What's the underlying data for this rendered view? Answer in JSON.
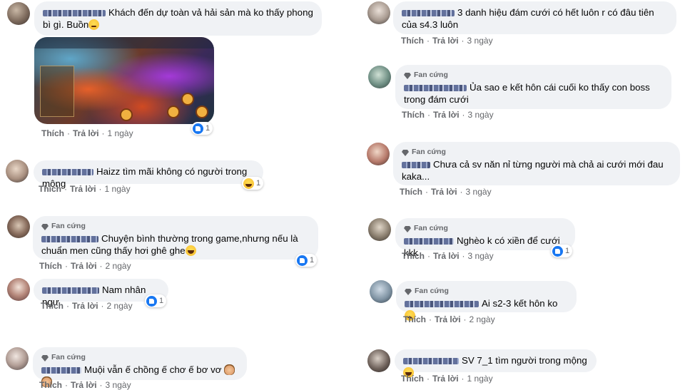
{
  "actions": {
    "like": "Thích",
    "reply": "Trả lời"
  },
  "badge_label": "Fan cứng",
  "comments": [
    {
      "text": "Khách đến dự toàn vả hải sản mà ko thấy phong bì gì. Buồn",
      "time": "1 ngày",
      "reaction_count": "1",
      "reaction": "like"
    },
    {
      "text": "Haizz tìm mãi không có người trong mộng",
      "time": "1 ngày",
      "reaction_count": "1",
      "reaction": "haha"
    },
    {
      "text": "Chuyện bình thường trong game,nhưng nếu là chuẩn men cũng thấy hơi ghê ghe",
      "time": "2 ngày",
      "reaction_count": "1",
      "reaction": "like"
    },
    {
      "text": "Nam nhân ngư",
      "time": "2 ngày",
      "reaction_count": "1",
      "reaction": "like"
    },
    {
      "text": "Muội vẫn ế chồng ế chơ ế bơ vơ",
      "time": "3 ngày"
    },
    {
      "text": "3 danh hiệu đám cưới có hết luôn r có đâu tiên của s4.3 luôn",
      "time": "3 ngày"
    },
    {
      "text": "Ủa sao e kết hôn cái cuối ko thấy con boss trong đám cưới",
      "time": "3 ngày"
    },
    {
      "text": "Chưa cả sv năn nỉ từng người mà chả ai cưới mới đau kaka...",
      "time": "3 ngày"
    },
    {
      "text": "Nghèo k có xiền để cưới kkk",
      "time": "3 ngày",
      "reaction_count": "1",
      "reaction": "like"
    },
    {
      "text": "Ai s2-3 kết hôn ko",
      "time": "2 ngày"
    },
    {
      "text": "SV 7_1 tìm người trong mộng",
      "time": "1 ngày"
    }
  ],
  "colors": {
    "bubble": "#f0f2f5",
    "action_text": "#65676b",
    "like_blue": "#1877f2"
  }
}
